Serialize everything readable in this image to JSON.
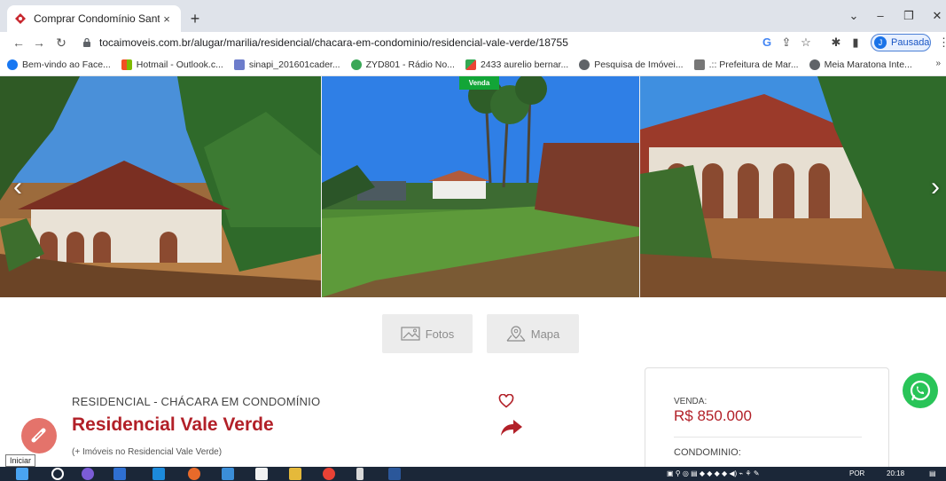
{
  "browser": {
    "tab_title": "Comprar Condomínio Santa Ge",
    "tab_close": "×",
    "new_tab": "+",
    "url": "tocaimoveis.com.br/alugar/marilia/residencial/chacara-em-condominio/residencial-vale-verde/18755",
    "profile_initial": "J",
    "profile_status": "Pausada",
    "bookmarks": [
      {
        "label": "Bem-vindo ao Face...",
        "icon": "facebook-icon",
        "color": "#1877f2"
      },
      {
        "label": "Hotmail - Outlook.c...",
        "icon": "microsoft-icon",
        "color": "#f25022"
      },
      {
        "label": "sinapi_201601cader...",
        "icon": "document-icon",
        "color": "#6d7dcb"
      },
      {
        "label": "ZYD801 - Rádio No...",
        "icon": "radio-icon",
        "color": "#3aa757"
      },
      {
        "label": "2433 aurelio bernar...",
        "icon": "maps-icon",
        "color": "#34a853"
      },
      {
        "label": "Pesquisa de Imóvei...",
        "icon": "globe-icon",
        "color": "#5f6368"
      },
      {
        "label": ".:: Prefeitura de Mar...",
        "icon": "city-icon",
        "color": "#777777"
      },
      {
        "label": "Meia Maratona Inte...",
        "icon": "globe-icon",
        "color": "#5f6368"
      }
    ],
    "bookmarks_more": "»"
  },
  "gallery": {
    "badge": "Venda",
    "badge_color": "#12a537",
    "prev_arrow": "‹",
    "next_arrow": "›"
  },
  "actions": {
    "photos_label": "Fotos",
    "map_label": "Mapa"
  },
  "property": {
    "type": "RESIDENCIAL - CHÁCARA EM CONDOMÍNIO",
    "title": "Residencial Vale Verde",
    "more_link": "(+ Imóveis no Residencial Vale Verde)",
    "accent_color": "#b22028"
  },
  "pricing": {
    "sale_label": "VENDA:",
    "sale_price": "R$ 850.000",
    "condo_label": "CONDOMINIO:"
  },
  "floating": {
    "tooltip": "Iniciar"
  },
  "taskbar": {
    "language": "POR",
    "time": "20:18"
  }
}
